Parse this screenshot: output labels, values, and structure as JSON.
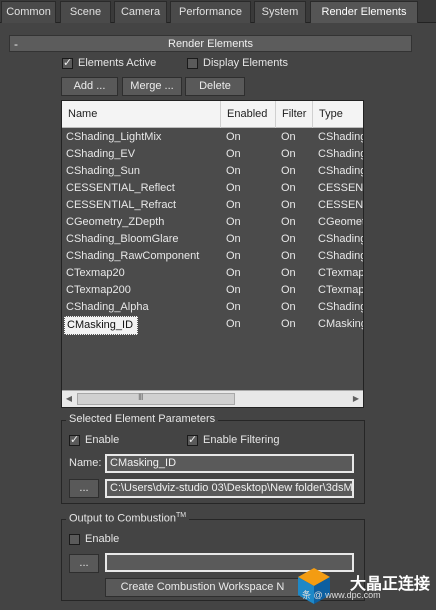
{
  "tabs": [
    "Common",
    "Scene",
    "Camera",
    "Performance",
    "System",
    "Render Elements"
  ],
  "rollout": {
    "collapse_symbol": "-",
    "title": "Render Elements"
  },
  "options": {
    "elements_active": {
      "label": "Elements Active",
      "checked": true
    },
    "display_elements": {
      "label": "Display Elements",
      "checked": false
    }
  },
  "buttons": {
    "add": "Add ...",
    "merge": "Merge ...",
    "delete": "Delete"
  },
  "list": {
    "columns": [
      "Name",
      "Enabled",
      "Filter",
      "Type"
    ],
    "rows": [
      [
        "CShading_LightMix",
        "On",
        "On",
        "CShading"
      ],
      [
        "CShading_EV",
        "On",
        "On",
        "CShading"
      ],
      [
        "CShading_Sun",
        "On",
        "On",
        "CShading"
      ],
      [
        "CESSENTIAL_Reflect",
        "On",
        "On",
        "CESSENT"
      ],
      [
        "CESSENTIAL_Refract",
        "On",
        "On",
        "CESSENT"
      ],
      [
        "CGeometry_ZDepth",
        "On",
        "On",
        "CGeomet"
      ],
      [
        "CShading_BloomGlare",
        "On",
        "On",
        "CShading"
      ],
      [
        "CShading_RawComponent",
        "On",
        "On",
        "CShading"
      ],
      [
        "CTexmap20",
        "On",
        "On",
        "CTexmap"
      ],
      [
        "CTexmap200",
        "On",
        "On",
        "CTexmap"
      ],
      [
        "CShading_Alpha",
        "On",
        "On",
        "CShading"
      ],
      [
        "CMasking_ID",
        "On",
        "On",
        "CMasking"
      ]
    ],
    "selected_index": 11,
    "scroll_left_icon": "◀",
    "scroll_right_icon": "▶",
    "scroll_grip": "III"
  },
  "selected_params": {
    "title": "Selected Element Parameters",
    "enable": {
      "label": "Enable",
      "checked": true
    },
    "enable_filtering": {
      "label": "Enable Filtering",
      "checked": true
    },
    "name_label": "Name:",
    "name_value": "CMasking_ID",
    "browse_button": "...",
    "path_value": "C:\\Users\\dviz-studio 03\\Desktop\\New folder\\3dsM"
  },
  "combustion": {
    "title": "Output to Combustion",
    "title_tm": "TM",
    "enable": {
      "label": "Enable",
      "checked": false
    },
    "browse_button": "...",
    "path_value": "",
    "create_button": "Create Combustion Workspace N"
  },
  "watermark": {
    "text": "大晶正连接",
    "sub": "条 @ www.dpc.com"
  }
}
